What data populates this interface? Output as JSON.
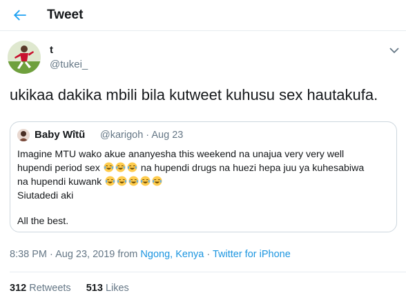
{
  "header": {
    "title": "Tweet"
  },
  "tweet": {
    "name": "t",
    "handle": "@tukei_",
    "text": "ukikaa dakika mbili bila kutweet kuhusu sex hautakufa."
  },
  "quote": {
    "name": "Baby Wîtũ",
    "handle": "@karigoh · Aug 23",
    "line1": "Imagine MTU wako akue ananyesha this weekend na unajua very very well",
    "line2a": "hupendi period sex",
    "line2b": "na hupendi drugs na huezi hepa juu ya kuhesabiwa",
    "line3": "na hupendi kuwank",
    "line4": "Siutadedi aki",
    "line5": "All the best.",
    "emoji_icon": "joy-emoji-icon"
  },
  "meta": {
    "time": "8:38 PM · Aug 23, 2019 from ",
    "location": "Ngong, Kenya",
    "sep": " · ",
    "source": "Twitter for iPhone"
  },
  "stats": {
    "retweets_count": "312",
    "retweets_label": "Retweets",
    "likes_count": "513",
    "likes_label": "Likes"
  },
  "colors": {
    "accent": "#1da1f2",
    "link": "#1b95e0",
    "secondary_text": "#657786",
    "border": "#ccd6dd"
  }
}
